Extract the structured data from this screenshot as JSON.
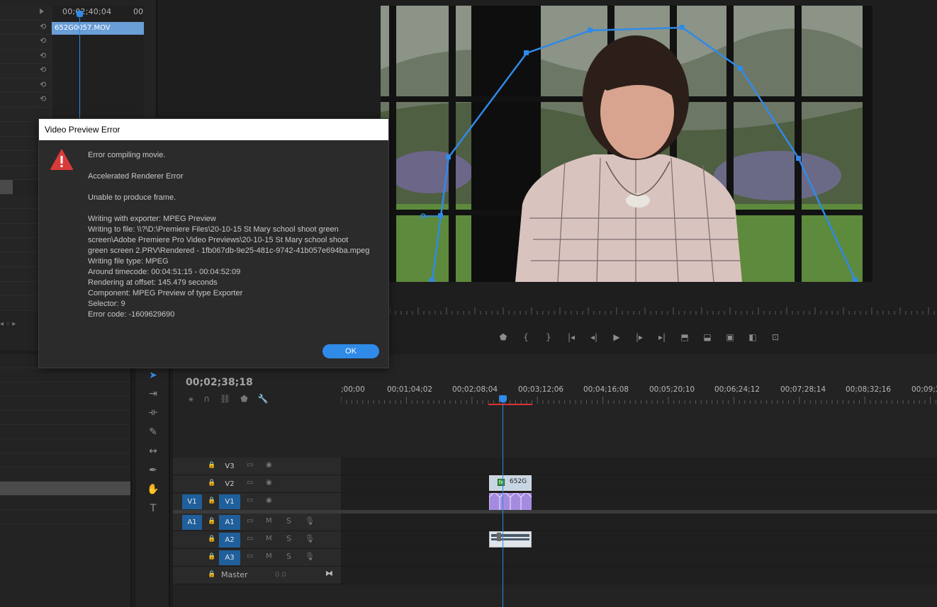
{
  "effect_controls": {
    "timecode": "00;02;40;04",
    "timecode_end": "00",
    "clip_name": "652G0057.MOV"
  },
  "dialog": {
    "title": "Video Preview Error",
    "line1": "Error compiling movie.",
    "line2": "Accelerated Renderer Error",
    "line3": "Unable to produce frame.",
    "details": [
      "Writing with exporter: MPEG Preview",
      "Writing to file: \\\\?\\D:\\Premiere Files\\20-10-15 St Mary school shoot green",
      "screen\\Adobe Premiere Pro Video Previews\\20-10-15 St Mary school shoot",
      "green screen 2.PRV\\Rendered - 1fb067db-9e25-481c-9742-41b057e694ba.mpeg",
      "Writing file type: MPEG",
      "Around timecode: 00:04:51:15 - 00:04:52:09",
      "Rendering at offset: 145.479 seconds",
      "Component: MPEG Preview of type Exporter",
      "Selector: 9",
      "Error code: -1609629690"
    ],
    "ok_label": "OK"
  },
  "timeline": {
    "timecode": "00;02;38;18",
    "ruler_labels": [
      ";00;00",
      "00;01;04;02",
      "00;02;08;04",
      "00;03;12;06",
      "00;04;16;08",
      "00;05;20;10",
      "00;06;24;12",
      "00;07;28;14",
      "00;08;32;16",
      "00;09;3"
    ],
    "tracks": {
      "v3": "V3",
      "v2": "V2",
      "v1_src": "V1",
      "v1": "V1",
      "a1_src": "A1",
      "a1": "A1",
      "a2": "A2",
      "a3": "A3",
      "master": "Master",
      "master_value": "0.0"
    },
    "clip_v2_label": "652G",
    "mute_label": "M",
    "solo_label": "S"
  },
  "colors": {
    "accent": "#2f8ae8",
    "patch": "#1f5f9b",
    "error": "#e03030",
    "video_clip": "#a58be0"
  }
}
